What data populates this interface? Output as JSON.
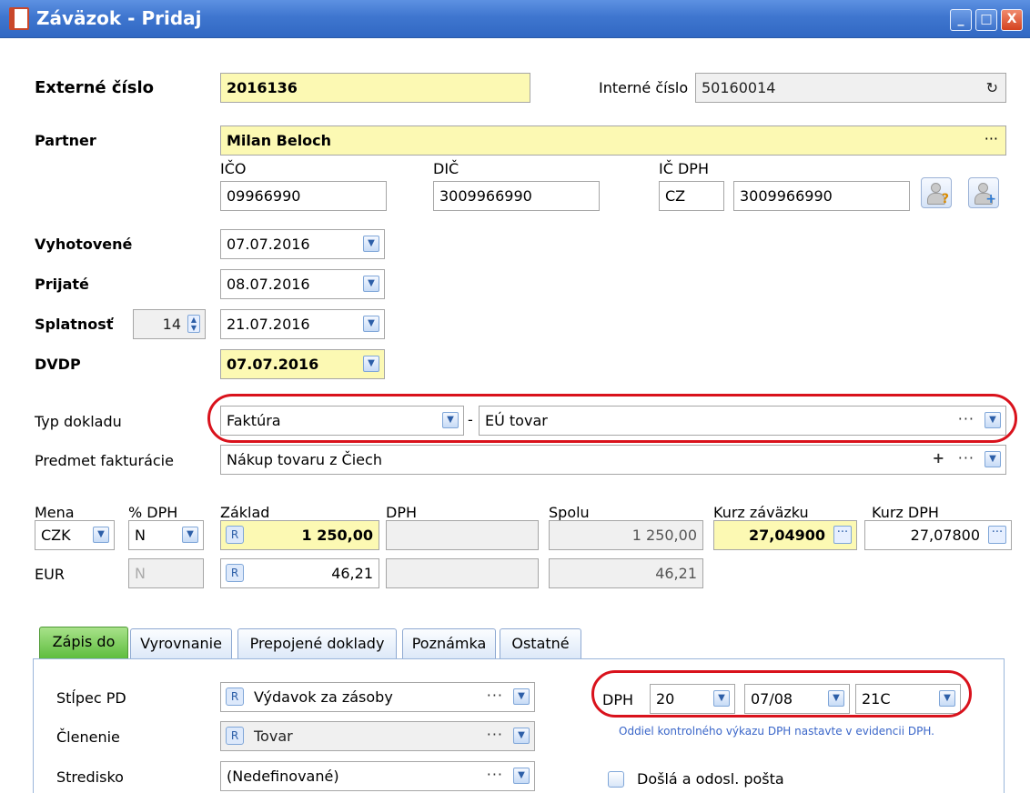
{
  "window": {
    "title": "Záväzok - Pridaj",
    "min_btn": "_",
    "max_btn": "□",
    "close_btn": "X"
  },
  "header": {
    "ext_label": "Externé číslo",
    "ext_value": "2016136",
    "int_label": "Interné číslo",
    "int_value": "50160014",
    "int_icon": "↻"
  },
  "partner": {
    "label": "Partner",
    "value": "Milan Beloch",
    "dots": "···",
    "ico_label": "IČO",
    "ico_value": "09966990",
    "dic_label": "DIČ",
    "dic_value": "3009966990",
    "icdph_label": "IČ DPH",
    "icdph_prefix": "CZ",
    "icdph_value": "3009966990",
    "lookup_icon": "?",
    "add_icon": "+"
  },
  "dates": {
    "vyhotovene_label": "Vyhotovené",
    "vyhotovene_value": "07.07.2016",
    "prijate_label": "Prijaté",
    "prijate_value": "08.07.2016",
    "splatnost_label": "Splatnosť",
    "splatnost_days": "14",
    "splatnost_value": "21.07.2016",
    "dvdp_label": "DVDP",
    "dvdp_value": "07.07.2016"
  },
  "doc": {
    "typ_label": "Typ dokladu",
    "typ_value": "Faktúra",
    "typ_sep": "-",
    "typ_sub": "EÚ tovar",
    "predmet_label": "Predmet fakturácie",
    "predmet_value": "Nákup tovaru z Čiech",
    "plus": "+",
    "dots": "···"
  },
  "amounts": {
    "mena_label": "Mena",
    "dph_pct_label": "% DPH",
    "zaklad_label": "Základ",
    "dph_label": "DPH",
    "spolu_label": "Spolu",
    "kurz_zav_label": "Kurz záväzku",
    "kurz_dph_label": "Kurz DPH",
    "r": "R",
    "row1": {
      "mena": "CZK",
      "dph_pct": "N",
      "zaklad": "1 250,00",
      "spolu": "1 250,00",
      "kurz_zav": "27,04900",
      "kurz_dph": "27,07800"
    },
    "row2": {
      "mena": "EUR",
      "dph_pct": "N",
      "zaklad": "46,21",
      "spolu": "46,21"
    }
  },
  "tabs": [
    {
      "label": "Zápis do"
    },
    {
      "label": "Vyrovnanie"
    },
    {
      "label": "Prepojené doklady"
    },
    {
      "label": "Poznámka"
    },
    {
      "label": "Ostatné"
    }
  ],
  "zapis": {
    "stlpec_label": "Stĺpec PD",
    "stlpec_value": "Výdavok za zásoby",
    "clenenie_label": "Členenie",
    "clenenie_value": "Tovar",
    "stredisko_label": "Stredisko",
    "stredisko_value": "(Nedefinované)",
    "dph_label": "DPH",
    "dph_rate": "20",
    "dph_period": "07/08",
    "dph_code": "21C",
    "hint": "Oddiel kontrolného výkazu DPH nastavte v evidencii DPH.",
    "posta_label": "Došlá a odosl. pošta",
    "dots": "···"
  },
  "colors": {
    "title_bar": "#3f76cf",
    "highlight_field": "#fcf9b3",
    "annotation_red": "#d9121c",
    "active_tab": "#5cbc3c"
  }
}
